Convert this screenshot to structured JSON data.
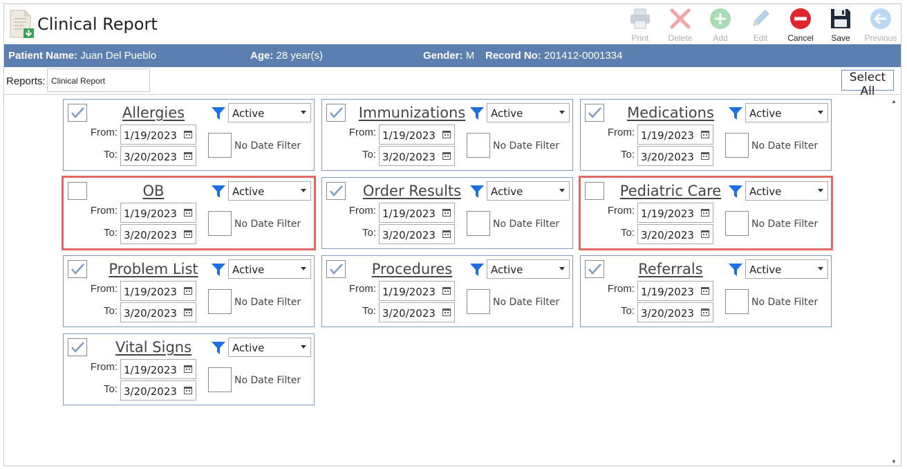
{
  "app": {
    "title": "Clinical Report"
  },
  "toolbar": {
    "print": "Print",
    "delete": "Delete",
    "add": "Add",
    "edit": "Edit",
    "cancel": "Cancel",
    "save": "Save",
    "previous": "Previous"
  },
  "patient": {
    "name_label": "Patient Name:",
    "name": "Juan Del Pueblo",
    "age_label": "Age:",
    "age": "28 year(s)",
    "gender_label": "Gender:",
    "gender": "M",
    "record_label": "Record No:",
    "record": "201412-0001334"
  },
  "reports": {
    "label": "Reports:",
    "value": "Clinical Report",
    "select_all": "Select All"
  },
  "labels": {
    "from": "From:",
    "to": "To:",
    "no_date_filter": "No Date Filter"
  },
  "cards": [
    {
      "title": "Allergies",
      "checked": true,
      "status": "Active",
      "from": "1/19/2023",
      "to": "3/20/2023"
    },
    {
      "title": "Immunizations",
      "checked": true,
      "status": "Active",
      "from": "1/19/2023",
      "to": "3/20/2023"
    },
    {
      "title": "Medications",
      "checked": true,
      "status": "Active",
      "from": "1/19/2023",
      "to": "3/20/2023"
    },
    {
      "title": "OB",
      "checked": false,
      "status": "Active",
      "from": "1/19/2023",
      "to": "3/20/2023"
    },
    {
      "title": "Order Results",
      "checked": true,
      "status": "Active",
      "from": "1/19/2023",
      "to": "3/20/2023"
    },
    {
      "title": "Pediatric Care",
      "checked": false,
      "status": "Active",
      "from": "1/19/2023",
      "to": "3/20/2023"
    },
    {
      "title": "Problem List",
      "checked": true,
      "status": "Active",
      "from": "1/19/2023",
      "to": "3/20/2023"
    },
    {
      "title": "Procedures",
      "checked": true,
      "status": "Active",
      "from": "1/19/2023",
      "to": "3/20/2023"
    },
    {
      "title": "Referrals",
      "checked": true,
      "status": "Active",
      "from": "1/19/2023",
      "to": "3/20/2023"
    },
    {
      "title": "Vital Signs",
      "checked": true,
      "status": "Active",
      "from": "1/19/2023",
      "to": "3/20/2023"
    }
  ]
}
